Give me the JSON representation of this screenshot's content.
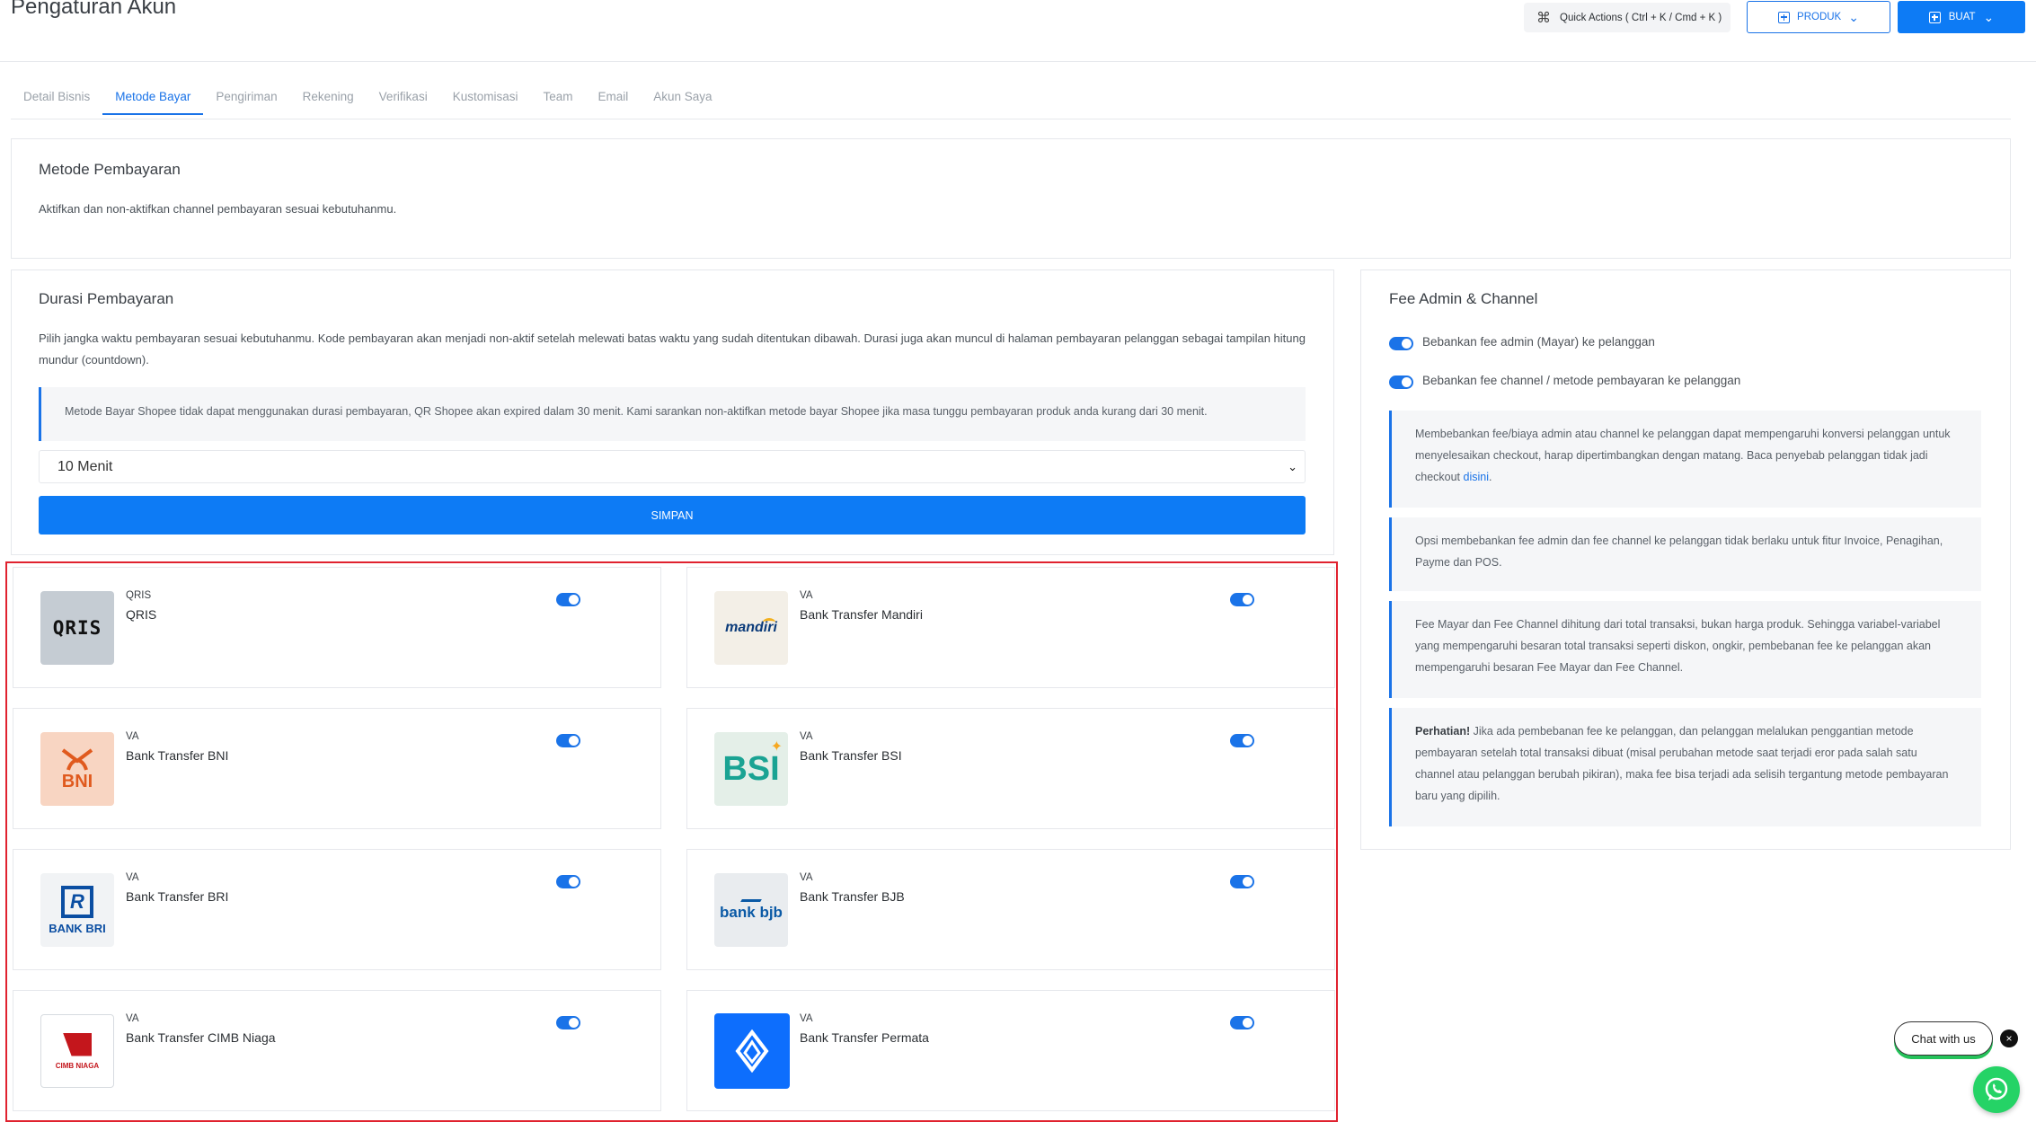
{
  "header": {
    "title": "Pengaturan Akun",
    "quick_actions_label": "Quick Actions ( Ctrl + K / Cmd + K )",
    "produk_label": "PRODUK",
    "buat_label": "BUAT"
  },
  "tabs": [
    {
      "label": "Detail Bisnis",
      "active": false
    },
    {
      "label": "Metode Bayar",
      "active": true
    },
    {
      "label": "Pengiriman",
      "active": false
    },
    {
      "label": "Rekening",
      "active": false
    },
    {
      "label": "Verifikasi",
      "active": false
    },
    {
      "label": "Kustomisasi",
      "active": false
    },
    {
      "label": "Team",
      "active": false
    },
    {
      "label": "Email",
      "active": false
    },
    {
      "label": "Akun Saya",
      "active": false
    }
  ],
  "metode_pembayaran": {
    "title": "Metode Pembayaran",
    "description": "Aktifkan dan non-aktifkan channel pembayaran sesuai kebutuhanmu."
  },
  "durasi": {
    "title": "Durasi Pembayaran",
    "description": "Pilih jangka waktu pembayaran sesuai kebutuhanmu. Kode pembayaran akan menjadi non-aktif setelah melewati batas waktu yang sudah ditentukan dibawah. Durasi juga akan muncul di halaman pembayaran pelanggan sebagai tampilan hitung mundur (countdown).",
    "alert": "Metode Bayar Shopee tidak dapat menggunakan durasi pembayaran, QR Shopee akan expired dalam 30 menit. Kami sarankan non-aktifkan metode bayar Shopee jika masa tunggu pembayaran produk anda kurang dari 30 menit.",
    "selected": "10 Menit",
    "save_label": "SIMPAN"
  },
  "fee": {
    "title": "Fee Admin & Channel",
    "toggle_admin_label": "Bebankan fee admin (Mayar) ke pelanggan",
    "toggle_channel_label": "Bebankan fee channel / metode pembayaran ke pelanggan",
    "toggle_admin_on": true,
    "toggle_channel_on": true,
    "notes": {
      "n1": "Membebankan fee/biaya admin atau channel ke pelanggan dapat mempengaruhi konversi pelanggan untuk menyelesaikan checkout, harap dipertimbangkan dengan matang. Baca penyebab pelanggan tidak jadi checkout",
      "n1_link": "disini",
      "n2": "Opsi membebankan fee admin dan fee channel ke pelanggan tidak berlaku untuk fitur Invoice, Penagihan, Payme dan POS.",
      "n3": "Fee Mayar dan Fee Channel dihitung dari total transaksi, bukan harga produk. Sehingga variabel-variabel yang mempengaruhi besaran total transaksi seperti diskon, ongkir, pembebanan fee ke pelanggan akan mempengaruhi besaran Fee Mayar dan Fee Channel.",
      "n4_bold": "Perhatian!",
      "n4": " Jika ada pembebanan fee ke pelanggan, dan pelanggan melalukan penggantian metode pembayaran setelah total transaksi dibuat (misal perubahan metode saat terjadi eror pada salah satu channel atau pelanggan berubah pikiran), maka fee bisa terjadi ada selisih tergantung metode pembayaran baru yang dipilih."
    }
  },
  "payments": [
    {
      "type": "QRIS",
      "name": "QRIS",
      "logo": "QRIS",
      "enabled": true
    },
    {
      "type": "VA",
      "name": "Bank Transfer Mandiri",
      "logo": "mandiri",
      "enabled": true
    },
    {
      "type": "VA",
      "name": "Bank Transfer BNI",
      "logo": "BNI",
      "enabled": true
    },
    {
      "type": "VA",
      "name": "Bank Transfer BSI",
      "logo": "BSI",
      "enabled": true
    },
    {
      "type": "VA",
      "name": "Bank Transfer BRI",
      "logo": "BANK BRI",
      "enabled": true
    },
    {
      "type": "VA",
      "name": "Bank Transfer BJB",
      "logo": "bank bjb",
      "enabled": true
    },
    {
      "type": "VA",
      "name": "Bank Transfer CIMB Niaga",
      "logo": "CIMB NIAGA",
      "enabled": true
    },
    {
      "type": "VA",
      "name": "Bank Transfer Permata",
      "logo": "permata-logo-icon",
      "enabled": true
    }
  ],
  "chat": {
    "label": "Chat with us",
    "close_glyph": "×"
  },
  "colors": {
    "primary": "#0d7bf5",
    "highlight": "#e0222f",
    "whatsapp": "#25d366"
  }
}
